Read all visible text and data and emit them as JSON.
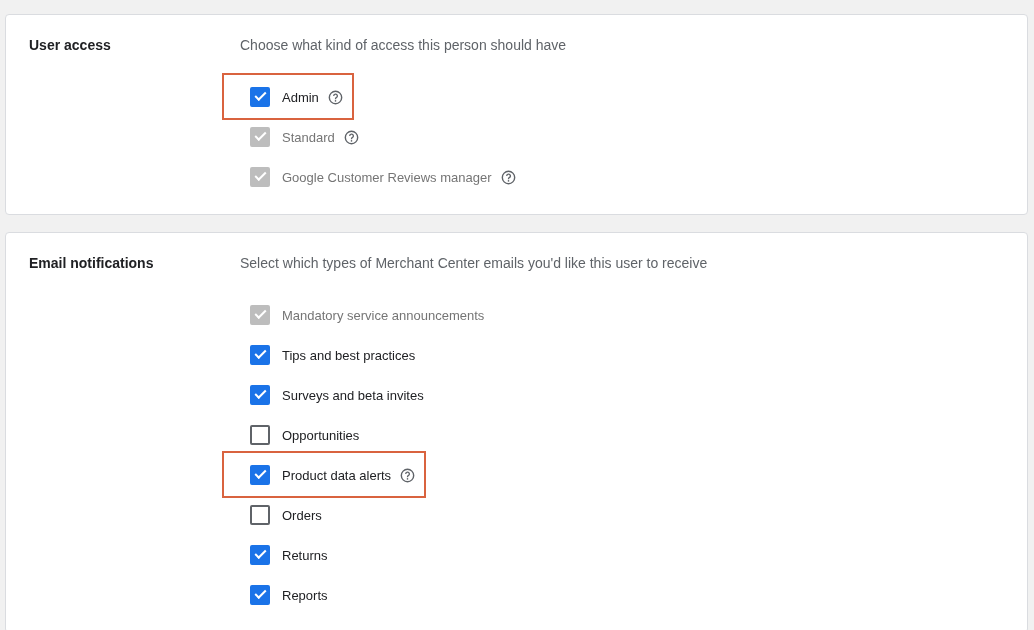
{
  "sections": [
    {
      "title": "User access",
      "description": "Choose what kind of access this person should have",
      "options": [
        {
          "label": "Admin",
          "checked": true,
          "disabled": false,
          "help": true,
          "highlighted": true
        },
        {
          "label": "Standard",
          "checked": true,
          "disabled": true,
          "help": true,
          "highlighted": false
        },
        {
          "label": "Google Customer Reviews manager",
          "checked": true,
          "disabled": true,
          "help": true,
          "highlighted": false
        }
      ]
    },
    {
      "title": "Email notifications",
      "description": "Select which types of Merchant Center emails you'd like this user to receive",
      "options": [
        {
          "label": "Mandatory service announcements",
          "checked": true,
          "disabled": true,
          "help": false,
          "highlighted": false
        },
        {
          "label": "Tips and best practices",
          "checked": true,
          "disabled": false,
          "help": false,
          "highlighted": false
        },
        {
          "label": "Surveys and beta invites",
          "checked": true,
          "disabled": false,
          "help": false,
          "highlighted": false
        },
        {
          "label": "Opportunities",
          "checked": false,
          "disabled": false,
          "help": false,
          "highlighted": false
        },
        {
          "label": "Product data alerts",
          "checked": true,
          "disabled": false,
          "help": true,
          "highlighted": true
        },
        {
          "label": "Orders",
          "checked": false,
          "disabled": false,
          "help": false,
          "highlighted": false
        },
        {
          "label": "Returns",
          "checked": true,
          "disabled": false,
          "help": false,
          "highlighted": false
        },
        {
          "label": "Reports",
          "checked": true,
          "disabled": false,
          "help": false,
          "highlighted": false
        }
      ]
    }
  ]
}
